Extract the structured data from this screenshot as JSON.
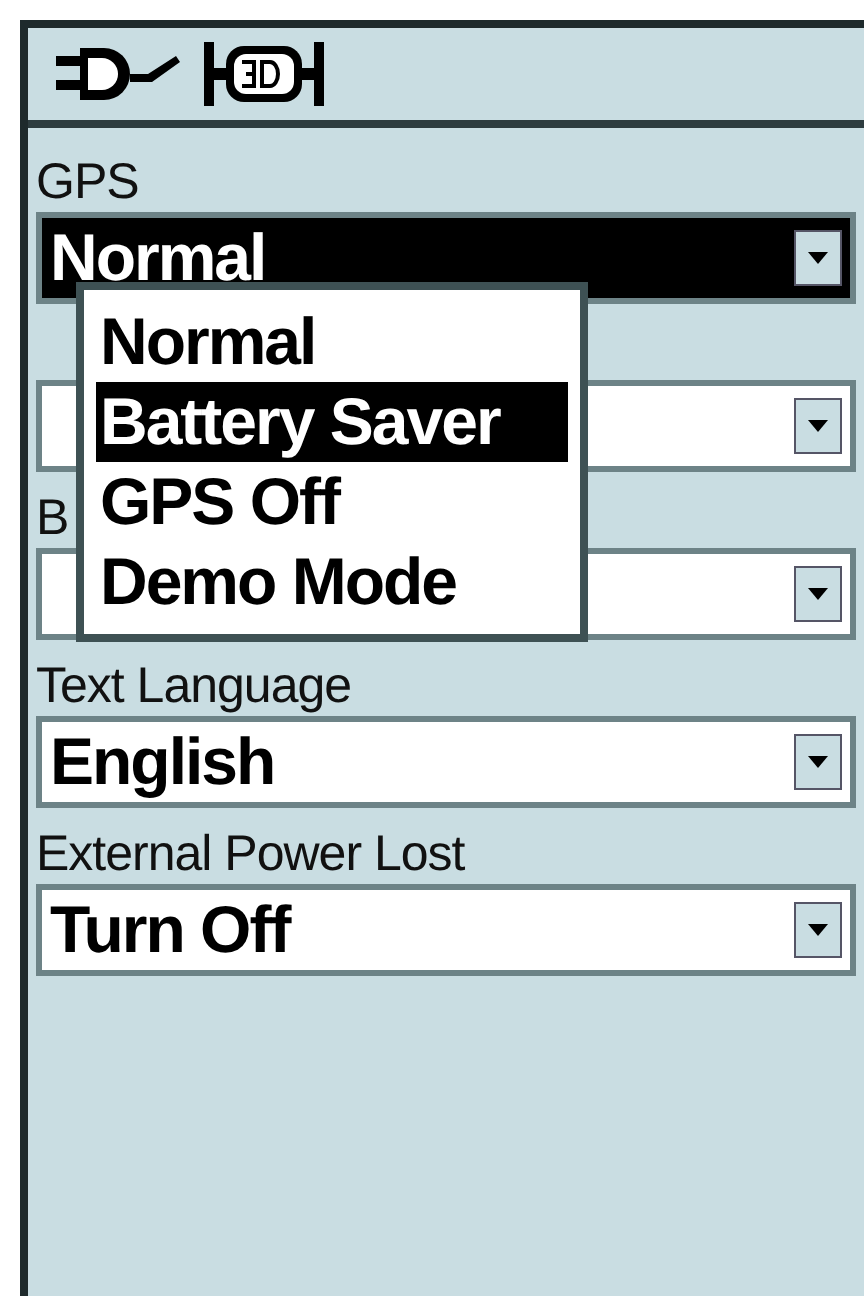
{
  "settings": [
    {
      "label": "GPS",
      "value": "Normal",
      "selected": true
    },
    {
      "selected": false
    },
    {
      "label": "B",
      "selected": false
    },
    {
      "label": "Text Language",
      "value": "English",
      "selected": false
    },
    {
      "label": "External Power Lost",
      "value": "Turn Off",
      "selected": false
    }
  ],
  "dropdown_menu": {
    "items": [
      {
        "label": "Normal",
        "selected": false
      },
      {
        "label": "Battery Saver",
        "selected": true
      },
      {
        "label": "GPS Off",
        "selected": false
      },
      {
        "label": "Demo Mode",
        "selected": false
      }
    ]
  }
}
